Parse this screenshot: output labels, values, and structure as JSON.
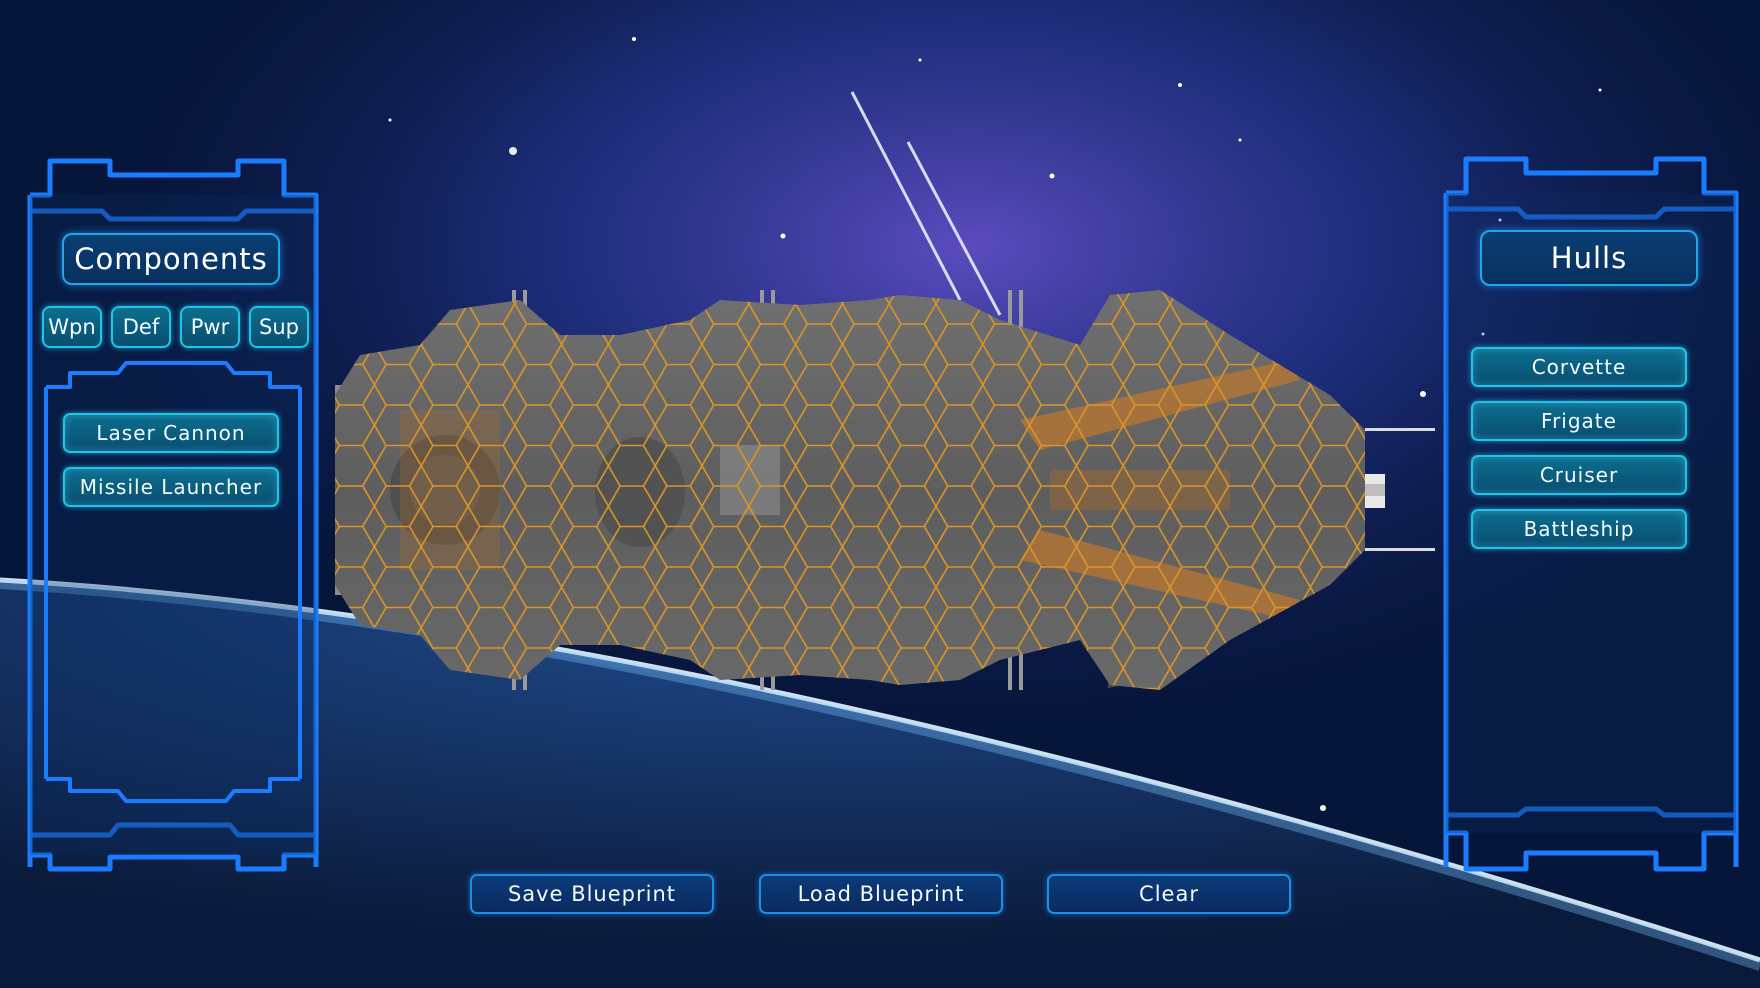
{
  "components_panel": {
    "title": "Components",
    "tabs": [
      "Wpn",
      "Def",
      "Pwr",
      "Sup"
    ],
    "items": [
      "Laser Cannon",
      "Missile Launcher"
    ]
  },
  "hulls_panel": {
    "title": "Hulls",
    "items": [
      "Corvette",
      "Frigate",
      "Cruiser",
      "Battleship"
    ]
  },
  "actions": {
    "save_label": "Save Blueprint",
    "load_label": "Load Blueprint",
    "clear_label": "Clear"
  },
  "colors": {
    "panel_frame": "#1a7dff",
    "button_cyan": "#1fc4e8",
    "hex_grid": "#d9952a",
    "ship_hull": "#6e6e6e",
    "space_bg": "#05112b"
  }
}
